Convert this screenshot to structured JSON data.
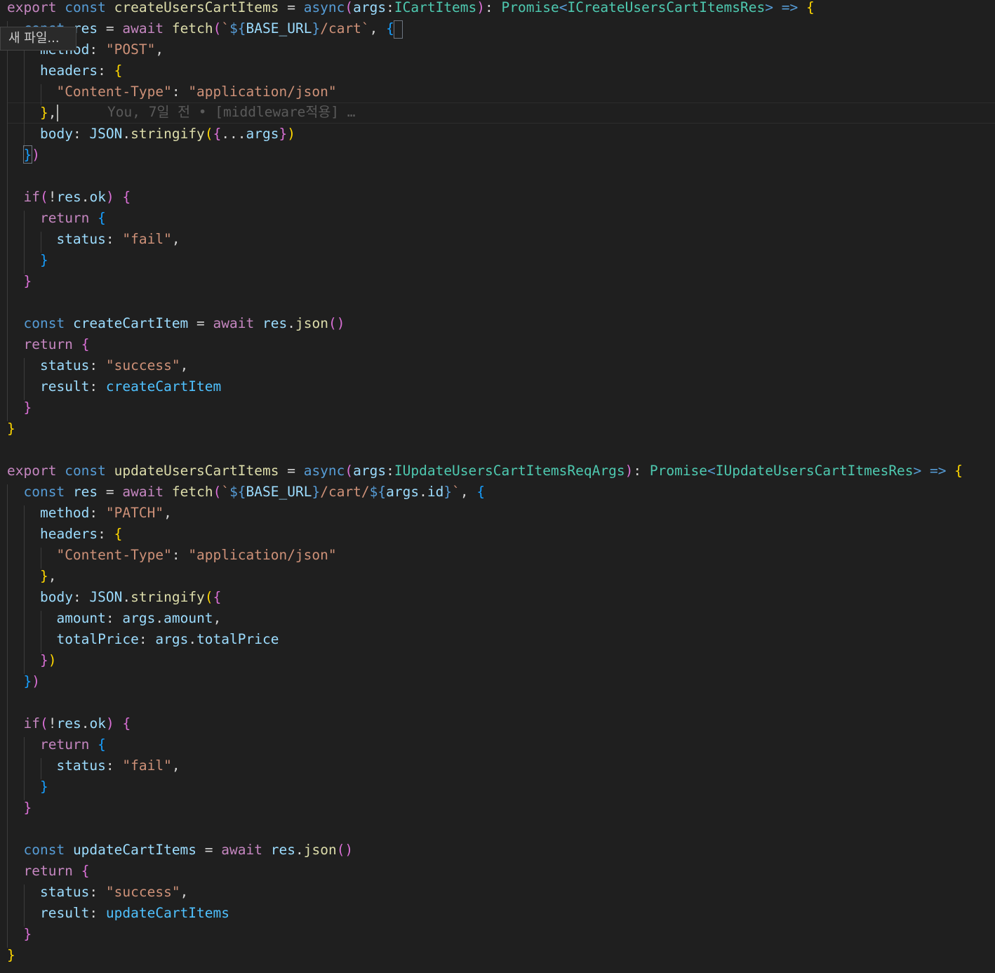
{
  "editor": {
    "theme": {
      "background": "#1f1f1f",
      "keyword": "#569cd6",
      "control": "#c586c0",
      "function": "#dcdcaa",
      "type": "#4ec9b0",
      "string": "#ce9178",
      "property": "#9cdcfe",
      "variable": "#4fc1ff",
      "plain": "#d4d4d4",
      "bracket_gold": "#ffd700",
      "bracket_pink": "#da70d6",
      "bracket_blue": "#179fff"
    },
    "tooltip": {
      "text": "새 파일..."
    },
    "blame": {
      "text": "You, 7일 전 • [middleware적용] …"
    },
    "lines": [
      [
        [
          "export",
          "c"
        ],
        [
          " ",
          "p"
        ],
        [
          "const",
          "k"
        ],
        [
          " ",
          "p"
        ],
        [
          "createUsersCartItems",
          "f"
        ],
        [
          " = ",
          "p"
        ],
        [
          "async",
          "k"
        ],
        [
          "(",
          "pk"
        ],
        [
          "args",
          "v"
        ],
        [
          ":",
          "p"
        ],
        [
          "ICartItems",
          "t"
        ],
        [
          ")",
          "pk"
        ],
        [
          ": ",
          "p"
        ],
        [
          "Promise",
          "t"
        ],
        [
          "<",
          "k"
        ],
        [
          "ICreateUsersCartItemsRes",
          "t"
        ],
        [
          ">",
          "k"
        ],
        [
          " ",
          "p"
        ],
        [
          "=>",
          "k"
        ],
        [
          " ",
          "p"
        ],
        [
          "{",
          "y"
        ]
      ],
      [
        [
          "  ",
          "p"
        ],
        [
          "const",
          "k"
        ],
        [
          " ",
          "p"
        ],
        [
          "res",
          "v"
        ],
        [
          " = ",
          "p"
        ],
        [
          "await",
          "c"
        ],
        [
          " ",
          "p"
        ],
        [
          "fetch",
          "f"
        ],
        [
          "(",
          "pk"
        ],
        [
          "`",
          "s"
        ],
        [
          "${",
          "k"
        ],
        [
          "BASE_URL",
          "v"
        ],
        [
          "}",
          "k"
        ],
        [
          "/cart`",
          "s"
        ],
        [
          ", ",
          "p"
        ],
        [
          "{",
          "b"
        ]
      ],
      [
        [
          "    ",
          "p"
        ],
        [
          "method",
          "v"
        ],
        [
          ": ",
          "p"
        ],
        [
          "\"POST\"",
          "s"
        ],
        [
          ",",
          "p"
        ]
      ],
      [
        [
          "    ",
          "p"
        ],
        [
          "headers",
          "v"
        ],
        [
          ": ",
          "p"
        ],
        [
          "{",
          "y"
        ]
      ],
      [
        [
          "      ",
          "p"
        ],
        [
          "\"Content-Type\"",
          "s"
        ],
        [
          ": ",
          "p"
        ],
        [
          "\"application/json\"",
          "s"
        ]
      ],
      [
        [
          "    ",
          "p"
        ],
        [
          "}",
          "y"
        ],
        [
          ",",
          "p"
        ]
      ],
      [
        [
          "    ",
          "p"
        ],
        [
          "body",
          "v"
        ],
        [
          ": ",
          "p"
        ],
        [
          "JSON",
          "v"
        ],
        [
          ".",
          "p"
        ],
        [
          "stringify",
          "f"
        ],
        [
          "(",
          "y"
        ],
        [
          "{",
          "pk"
        ],
        [
          "...",
          "p"
        ],
        [
          "args",
          "v"
        ],
        [
          "}",
          "pk"
        ],
        [
          ")",
          "y"
        ]
      ],
      [
        [
          "  ",
          "p"
        ],
        [
          "}",
          "b"
        ],
        [
          ")",
          "pk"
        ]
      ],
      [],
      [
        [
          "  ",
          "p"
        ],
        [
          "if",
          "c"
        ],
        [
          "(",
          "pk"
        ],
        [
          "!",
          "p"
        ],
        [
          "res",
          "v"
        ],
        [
          ".",
          "p"
        ],
        [
          "ok",
          "v"
        ],
        [
          ")",
          "pk"
        ],
        [
          " ",
          "p"
        ],
        [
          "{",
          "pk"
        ]
      ],
      [
        [
          "    ",
          "p"
        ],
        [
          "return",
          "c"
        ],
        [
          " ",
          "p"
        ],
        [
          "{",
          "b"
        ]
      ],
      [
        [
          "      ",
          "p"
        ],
        [
          "status",
          "v"
        ],
        [
          ": ",
          "p"
        ],
        [
          "\"fail\"",
          "s"
        ],
        [
          ",",
          "p"
        ]
      ],
      [
        [
          "    ",
          "p"
        ],
        [
          "}",
          "b"
        ]
      ],
      [
        [
          "  ",
          "p"
        ],
        [
          "}",
          "pk"
        ]
      ],
      [],
      [
        [
          "  ",
          "p"
        ],
        [
          "const",
          "k"
        ],
        [
          " ",
          "p"
        ],
        [
          "createCartItem",
          "v"
        ],
        [
          " = ",
          "p"
        ],
        [
          "await",
          "c"
        ],
        [
          " ",
          "p"
        ],
        [
          "res",
          "v"
        ],
        [
          ".",
          "p"
        ],
        [
          "json",
          "f"
        ],
        [
          "()",
          "pk"
        ]
      ],
      [
        [
          "  ",
          "p"
        ],
        [
          "return",
          "c"
        ],
        [
          " ",
          "p"
        ],
        [
          "{",
          "pk"
        ]
      ],
      [
        [
          "    ",
          "p"
        ],
        [
          "status",
          "v"
        ],
        [
          ": ",
          "p"
        ],
        [
          "\"success\"",
          "s"
        ],
        [
          ",",
          "p"
        ]
      ],
      [
        [
          "    ",
          "p"
        ],
        [
          "result",
          "v"
        ],
        [
          ": ",
          "p"
        ],
        [
          "createCartItem",
          "var"
        ]
      ],
      [
        [
          "  ",
          "p"
        ],
        [
          "}",
          "pk"
        ]
      ],
      [
        [
          "}",
          "y"
        ]
      ],
      [],
      [
        [
          "export",
          "c"
        ],
        [
          " ",
          "p"
        ],
        [
          "const",
          "k"
        ],
        [
          " ",
          "p"
        ],
        [
          "updateUsersCartItems",
          "f"
        ],
        [
          " = ",
          "p"
        ],
        [
          "async",
          "k"
        ],
        [
          "(",
          "pk"
        ],
        [
          "args",
          "v"
        ],
        [
          ":",
          "p"
        ],
        [
          "IUpdateUsersCartItemsReqArgs",
          "t"
        ],
        [
          ")",
          "pk"
        ],
        [
          ": ",
          "p"
        ],
        [
          "Promise",
          "t"
        ],
        [
          "<",
          "k"
        ],
        [
          "IUpdateUsersCartItmesRes",
          "t"
        ],
        [
          ">",
          "k"
        ],
        [
          " ",
          "p"
        ],
        [
          "=>",
          "k"
        ],
        [
          " ",
          "p"
        ],
        [
          "{",
          "y"
        ]
      ],
      [
        [
          "  ",
          "p"
        ],
        [
          "const",
          "k"
        ],
        [
          " ",
          "p"
        ],
        [
          "res",
          "v"
        ],
        [
          " = ",
          "p"
        ],
        [
          "await",
          "c"
        ],
        [
          " ",
          "p"
        ],
        [
          "fetch",
          "f"
        ],
        [
          "(",
          "pk"
        ],
        [
          "`",
          "s"
        ],
        [
          "${",
          "k"
        ],
        [
          "BASE_URL",
          "v"
        ],
        [
          "}",
          "k"
        ],
        [
          "/cart/",
          "s"
        ],
        [
          "${",
          "k"
        ],
        [
          "args",
          "v"
        ],
        [
          ".",
          "p"
        ],
        [
          "id",
          "v"
        ],
        [
          "}",
          "k"
        ],
        [
          "`",
          "s"
        ],
        [
          ", ",
          "p"
        ],
        [
          "{",
          "b"
        ]
      ],
      [
        [
          "    ",
          "p"
        ],
        [
          "method",
          "v"
        ],
        [
          ": ",
          "p"
        ],
        [
          "\"PATCH\"",
          "s"
        ],
        [
          ",",
          "p"
        ]
      ],
      [
        [
          "    ",
          "p"
        ],
        [
          "headers",
          "v"
        ],
        [
          ": ",
          "p"
        ],
        [
          "{",
          "y"
        ]
      ],
      [
        [
          "      ",
          "p"
        ],
        [
          "\"Content-Type\"",
          "s"
        ],
        [
          ": ",
          "p"
        ],
        [
          "\"application/json\"",
          "s"
        ]
      ],
      [
        [
          "    ",
          "p"
        ],
        [
          "}",
          "y"
        ],
        [
          ",",
          "p"
        ]
      ],
      [
        [
          "    ",
          "p"
        ],
        [
          "body",
          "v"
        ],
        [
          ": ",
          "p"
        ],
        [
          "JSON",
          "v"
        ],
        [
          ".",
          "p"
        ],
        [
          "stringify",
          "f"
        ],
        [
          "(",
          "y"
        ],
        [
          "{",
          "pk"
        ]
      ],
      [
        [
          "      ",
          "p"
        ],
        [
          "amount",
          "v"
        ],
        [
          ": ",
          "p"
        ],
        [
          "args",
          "v"
        ],
        [
          ".",
          "p"
        ],
        [
          "amount",
          "v"
        ],
        [
          ",",
          "p"
        ]
      ],
      [
        [
          "      ",
          "p"
        ],
        [
          "totalPrice",
          "v"
        ],
        [
          ": ",
          "p"
        ],
        [
          "args",
          "v"
        ],
        [
          ".",
          "p"
        ],
        [
          "totalPrice",
          "v"
        ]
      ],
      [
        [
          "    ",
          "p"
        ],
        [
          "}",
          "pk"
        ],
        [
          ")",
          "y"
        ]
      ],
      [
        [
          "  ",
          "p"
        ],
        [
          "}",
          "b"
        ],
        [
          ")",
          "pk"
        ]
      ],
      [],
      [
        [
          "  ",
          "p"
        ],
        [
          "if",
          "c"
        ],
        [
          "(",
          "pk"
        ],
        [
          "!",
          "p"
        ],
        [
          "res",
          "v"
        ],
        [
          ".",
          "p"
        ],
        [
          "ok",
          "v"
        ],
        [
          ")",
          "pk"
        ],
        [
          " ",
          "p"
        ],
        [
          "{",
          "pk"
        ]
      ],
      [
        [
          "    ",
          "p"
        ],
        [
          "return",
          "c"
        ],
        [
          " ",
          "p"
        ],
        [
          "{",
          "b"
        ]
      ],
      [
        [
          "      ",
          "p"
        ],
        [
          "status",
          "v"
        ],
        [
          ": ",
          "p"
        ],
        [
          "\"fail\"",
          "s"
        ],
        [
          ",",
          "p"
        ]
      ],
      [
        [
          "    ",
          "p"
        ],
        [
          "}",
          "b"
        ]
      ],
      [
        [
          "  ",
          "p"
        ],
        [
          "}",
          "pk"
        ]
      ],
      [],
      [
        [
          "  ",
          "p"
        ],
        [
          "const",
          "k"
        ],
        [
          " ",
          "p"
        ],
        [
          "updateCartItems",
          "v"
        ],
        [
          " = ",
          "p"
        ],
        [
          "await",
          "c"
        ],
        [
          " ",
          "p"
        ],
        [
          "res",
          "v"
        ],
        [
          ".",
          "p"
        ],
        [
          "json",
          "f"
        ],
        [
          "()",
          "pk"
        ]
      ],
      [
        [
          "  ",
          "p"
        ],
        [
          "return",
          "c"
        ],
        [
          " ",
          "p"
        ],
        [
          "{",
          "pk"
        ]
      ],
      [
        [
          "    ",
          "p"
        ],
        [
          "status",
          "v"
        ],
        [
          ": ",
          "p"
        ],
        [
          "\"success\"",
          "s"
        ],
        [
          ",",
          "p"
        ]
      ],
      [
        [
          "    ",
          "p"
        ],
        [
          "result",
          "v"
        ],
        [
          ": ",
          "p"
        ],
        [
          "updateCartItems",
          "var"
        ]
      ],
      [
        [
          "  ",
          "p"
        ],
        [
          "}",
          "pk"
        ]
      ],
      [
        [
          "}",
          "y"
        ]
      ]
    ]
  }
}
